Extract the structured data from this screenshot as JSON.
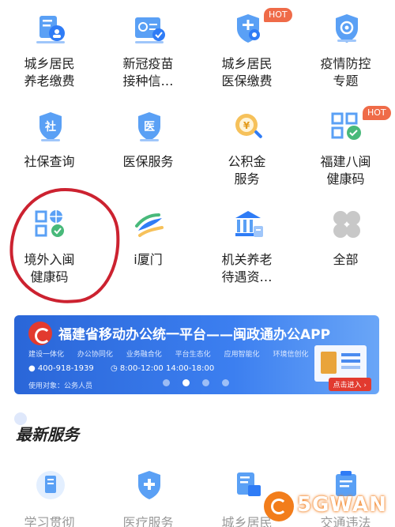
{
  "grid": {
    "items": [
      {
        "icon": "pension-icon",
        "lines": [
          "城乡居民",
          "养老缴费"
        ],
        "badge": ""
      },
      {
        "icon": "vaccine-icon",
        "lines": [
          "新冠疫苗",
          "接种信…"
        ],
        "badge": ""
      },
      {
        "icon": "medical-insurance-shield-icon",
        "lines": [
          "城乡居民",
          "医保缴费"
        ],
        "badge": "HOT"
      },
      {
        "icon": "epidemic-shield-icon",
        "lines": [
          "疫情防控",
          "专题"
        ],
        "badge": ""
      },
      {
        "icon": "social-security-shield-icon",
        "lines": [
          "社保查询"
        ],
        "badge": ""
      },
      {
        "icon": "medical-shield-icon",
        "lines": [
          "医保服务"
        ],
        "badge": ""
      },
      {
        "icon": "housing-fund-icon",
        "lines": [
          "公积金",
          "服务"
        ],
        "badge": ""
      },
      {
        "icon": "health-code-icon",
        "lines": [
          "福建八闽",
          "健康码"
        ],
        "badge": "HOT"
      },
      {
        "icon": "overseas-health-code-icon",
        "lines": [
          "境外入闽",
          "健康码"
        ],
        "badge": ""
      },
      {
        "icon": "ixiamen-logo-icon",
        "lines": [
          "i厦门"
        ],
        "badge": ""
      },
      {
        "icon": "government-building-icon",
        "lines": [
          "机关养老",
          "待遇资…"
        ],
        "badge": ""
      },
      {
        "icon": "all-services-icon",
        "lines": [
          "全部"
        ],
        "badge": ""
      }
    ]
  },
  "banner": {
    "title": "福建省移动办公统一平台——闽政通办公APP",
    "tags": [
      "建设一体化",
      "办公协同化",
      "业务融合化",
      "平台生态化",
      "应用智能化",
      "环境信创化"
    ],
    "phone": "400-918-1939",
    "hours": "8:00-12:00 14:00-18:00",
    "audience": "使用对象：公务人员",
    "enter": "点击进入 ›",
    "pager": {
      "count": 4,
      "active": 1
    }
  },
  "latest": {
    "title": "最新服务",
    "items": [
      {
        "icon": "study-icon",
        "label": "学习贯彻"
      },
      {
        "icon": "medical-service-icon",
        "label": "医疗服务"
      },
      {
        "icon": "rural-resident-icon",
        "label": "城乡居民"
      },
      {
        "icon": "traffic-violation-icon",
        "label": "交通违法"
      }
    ]
  },
  "watermark": {
    "text": "5GWAN"
  },
  "colors": {
    "accent": "#2f7cf6",
    "hot": "#ef6b48",
    "highlight": "#cc2230"
  }
}
